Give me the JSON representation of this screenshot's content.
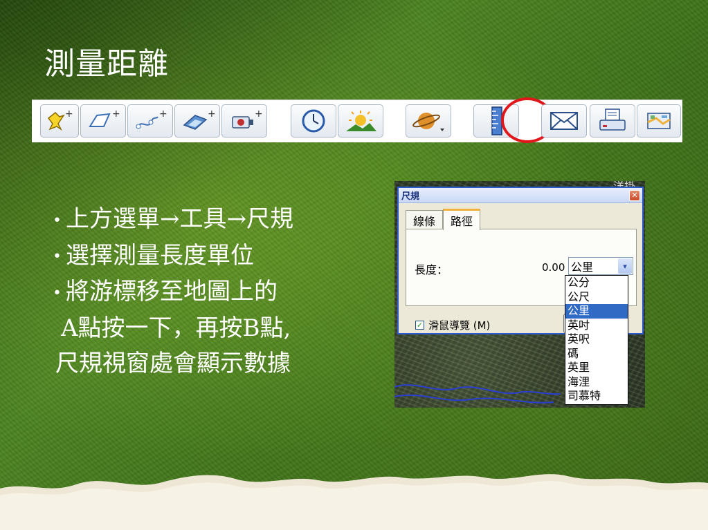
{
  "slide": {
    "title": "測量距離"
  },
  "toolbar": {
    "buttons": [
      {
        "name": "add-placemark",
        "icon": "pushpin-plus-icon"
      },
      {
        "name": "add-polygon",
        "icon": "polygon-plus-icon"
      },
      {
        "name": "add-path",
        "icon": "path-plus-icon"
      },
      {
        "name": "add-image-overlay",
        "icon": "image-overlay-plus-icon"
      },
      {
        "name": "record-tour",
        "icon": "camera-plus-icon"
      },
      {
        "name": "historical-imagery",
        "icon": "clock-icon"
      },
      {
        "name": "sunlight",
        "icon": "sun-landscape-icon"
      },
      {
        "name": "switch-planet",
        "icon": "planet-icon"
      },
      {
        "name": "ruler",
        "icon": "ruler-icon"
      },
      {
        "name": "email",
        "icon": "envelope-icon"
      },
      {
        "name": "print",
        "icon": "printer-icon"
      },
      {
        "name": "view-in-maps",
        "icon": "map-icon"
      }
    ],
    "highlight_color": "#e0181c"
  },
  "bullets": [
    {
      "bullet": "•",
      "text": "上方選單→工具→尺規"
    },
    {
      "bullet": "•",
      "text": "選擇測量長度單位"
    },
    {
      "bullet": "•",
      "text": "將游標移至地圖上的"
    },
    {
      "bullet": "",
      "text": "A點按一下，再按B點,"
    },
    {
      "bullet": "",
      "text": "尺規視窗處會顯示數據"
    }
  ],
  "ruler_dialog": {
    "title": "尺規",
    "close_glyph": "✕",
    "map_corner_text": "洋掛",
    "tabs": [
      {
        "label": "線條",
        "active": false
      },
      {
        "label": "路徑",
        "active": true
      }
    ],
    "length_label": "長度：",
    "length_value": "0.00",
    "unit_selected": "公里",
    "unit_options": [
      "公分",
      "公尺",
      "公里",
      "英吋",
      "英呎",
      "碼",
      "英里",
      "海浬",
      "司慕特"
    ],
    "selected_index": 2,
    "mouse_nav_label": "滑鼠導覽 (M)",
    "mouse_nav_checked": true,
    "check_glyph": "✓",
    "arrow_glyph": "▾"
  }
}
